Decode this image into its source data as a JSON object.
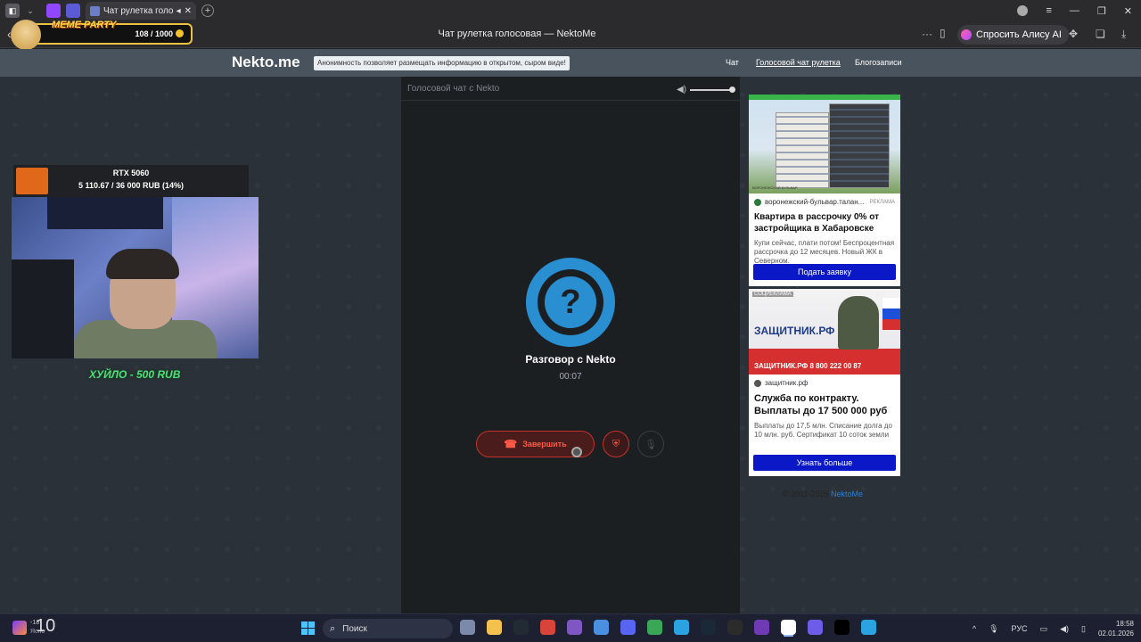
{
  "browser": {
    "tab_title": "Чат рулетка голосо",
    "page_title": "Чат рулетка голосовая — NektoMe",
    "alice_label": "Спросить Алису AI"
  },
  "overlay": {
    "meme_title": "MEME PARTY",
    "meme_count": "108 / 1000",
    "goal_name": "RTX 5060",
    "goal_value": "5 110.67 / 36 000 RUB (14%)",
    "goal_progress_percent": 14,
    "donation_text": "ХУЙЛО - 500 RUB"
  },
  "site": {
    "logo": "Nekto.me",
    "tagline": "Анонимность позволяет размещать информацию в открытом, сыром виде!",
    "nav": [
      "Чат",
      "Голосовой чат рулетка",
      "Блогозаписи"
    ],
    "chat_header": "Голосовой чат с Nekto",
    "conversation_title": "Разговор с Nekto",
    "timer": "00:07",
    "end_button": "Завершить",
    "question_mark": "?",
    "copyright": "© 2011-2025",
    "copyright_link": "NektoMe"
  },
  "ads": [
    {
      "image_caption": "ВОРОНЕЖСКИЙ БУЛЬВАР",
      "source": "воронежский-бульвар.талан...",
      "label": "РЕКЛАМА",
      "headline": "Квартира в рассрочку 0% от застройщика в Хабаровске",
      "description": "Купи сейчас, плати потом! Беспроцентная рассрочка до 12 месяцев. Новый ЖК в Северном.",
      "cta": "Подать заявку"
    },
    {
      "image_tag": "СОЦРЕКЛАМА",
      "image_brand": "ЗАЩИТНИК.РФ",
      "image_phone": "ЗАЩИТНИК.РФ  8 800 222 00 87",
      "source": "защитник.рф",
      "headline": "Служба по контракту. Выплаты до 17 500 000 руб",
      "description": "Выплаты до 17,5 млн. Списание долга до 10 млн. руб. Сертификат 10 соток земли",
      "cta": "Узнать больше"
    }
  ],
  "taskbar": {
    "weather_temp": "-18",
    "weather_status": "Ясно",
    "overlay_number": "10",
    "search_placeholder": "Поиск",
    "language": "РУС",
    "time": "18:58",
    "date": "02.01.2026",
    "apps": [
      {
        "name": "files-app",
        "color": "#7a8aa8"
      },
      {
        "name": "folder-app",
        "color": "#f2c14e"
      },
      {
        "name": "game-app",
        "color": "#222a33"
      },
      {
        "name": "chrome-app",
        "color": "#d9443a"
      },
      {
        "name": "obs-app",
        "color": "#7e57c2"
      },
      {
        "name": "store-app",
        "color": "#4a8fe0"
      },
      {
        "name": "discord-app",
        "color": "#5865f2"
      },
      {
        "name": "browser-app",
        "color": "#3aa757"
      },
      {
        "name": "telegram-app",
        "color": "#2aa3e0"
      },
      {
        "name": "steam-app",
        "color": "#1b2838"
      },
      {
        "name": "capcut-app",
        "color": "#2b2b2b"
      },
      {
        "name": "vs-app",
        "color": "#6f3bb5"
      },
      {
        "name": "yandex-app",
        "color": "#ffffff"
      },
      {
        "name": "tool-app",
        "color": "#6c5ce7"
      },
      {
        "name": "x-app",
        "color": "#000000"
      },
      {
        "name": "telegram2-app",
        "color": "#2aa3e0"
      }
    ]
  }
}
